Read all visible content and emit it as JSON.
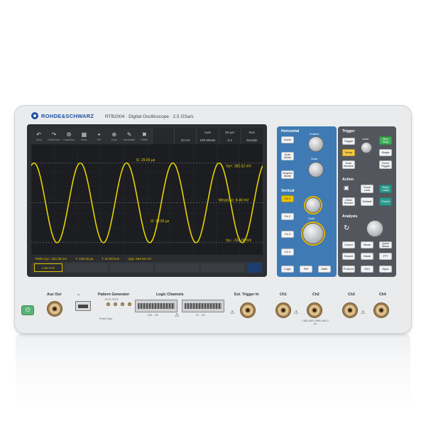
{
  "brand": "ROHDE&SCHWARZ",
  "model_title": "RTB2004 · Digital Oscilloscope · 2.5 GSa/s",
  "toolbar": [
    {
      "icon": "back-arrow-icon",
      "glyph": "↶",
      "label": "Undo"
    },
    {
      "icon": "redo-arrow-icon",
      "glyph": "↷",
      "label": "Redo/Undo"
    },
    {
      "icon": "gear-icon",
      "glyph": "⚙",
      "label": "Load/Save"
    },
    {
      "icon": "grid-icon",
      "glyph": "▦",
      "label": "Meas"
    },
    {
      "icon": "cursor-icon",
      "glyph": "⌖",
      "label": "Ref"
    },
    {
      "icon": "zoom-icon",
      "glyph": "⊕",
      "label": "Zoom"
    },
    {
      "icon": "annotate-icon",
      "glyph": "✎",
      "label": "Annotation"
    },
    {
      "icon": "delete-icon",
      "glyph": "✖",
      "label": "Delete"
    }
  ],
  "params": [
    "",
    "",
    "Auto",
    "50 µs/",
    "Run",
    "",
    "10 mV",
    "100 MSa/s",
    "0 s",
    "Sample"
  ],
  "measurements": {
    "vp_plus": "Vp+: 382.52 mV",
    "vp_minus": "Vp-: -312.08 mV",
    "mean": "MeanCyc: 8.40 mV",
    "cursor1": "t1: 29.05 µs",
    "cursor2": "t2: 29.02 µs"
  },
  "status": [
    "RMS-Cyc: 223.35 mV",
    "T: 100.00 µs",
    "f: 10.00 kHz",
    "Upp: 694.53 mV"
  ],
  "channel_badge": "1.00 mV/",
  "horizontal": {
    "title": "Horizontal",
    "position_label": "Position",
    "scale_label": "Scale",
    "buttons": {
      "zoom": "Zoom",
      "auto_meas": "Auto Meas",
      "acquire": "Acquire Mode"
    }
  },
  "vertical": {
    "title": "Vertical",
    "position_label": "Position",
    "scale_label": "Scale",
    "channels": [
      "Ch 1",
      "Ch 2",
      "Ch 3",
      "Ch 4"
    ],
    "bottom": [
      "Logic",
      "Ref",
      "Math"
    ]
  },
  "trigger": {
    "title": "Trigger",
    "level_label": "Level",
    "buttons": {
      "trigger": "Trigger",
      "run_stop": "Run Stop",
      "setup": "Setup",
      "single": "Single",
      "auto_normal": "Auto Normal",
      "force_trigger": "Force Trigger"
    }
  },
  "action": {
    "title": "Action",
    "buttons": {
      "touch_lock": "Touch Lock",
      "save_load": "Save Load",
      "clear_screen": "Clear Screen",
      "default": "Default",
      "preset": "Preset"
    }
  },
  "analysis": {
    "title": "Analysis",
    "buttons": {
      "cursor": "Cursor",
      "meas": "Meas",
      "quick_meas": "Quick Meas",
      "search": "Search",
      "mask": "Mask",
      "fft": "FFT",
      "protocol": "Protocol",
      "gen": "Gen",
      "apps": "Apps"
    }
  },
  "front": {
    "aux_out": "Aux Out",
    "pattern_gen": "Pattern Generator",
    "pattern_pins": "P0  P1  P2  P3",
    "probe_comp": "Probe Comp.",
    "logic_channels": "Logic Channels",
    "logic_low": "D15 ... D8",
    "logic_high": "D7 ... D0",
    "ext_trigger": "Ext. Trigger In",
    "ch1": "Ch1",
    "ch2": "Ch2",
    "ch3": "Ch3",
    "ch4": "Ch4",
    "input_spec": "1 MΩ ≤300 V RMS ≤400 V pk"
  },
  "chart_data": {
    "type": "line",
    "series": [
      {
        "name": "Ch1",
        "shape": "sine",
        "color": "#e6d200"
      }
    ],
    "frequency": "10.00 kHz",
    "period": "100.00 µs",
    "vp_plus": 382.52,
    "vp_minus": -312.08,
    "cycles_visible": 5,
    "grid": true
  }
}
